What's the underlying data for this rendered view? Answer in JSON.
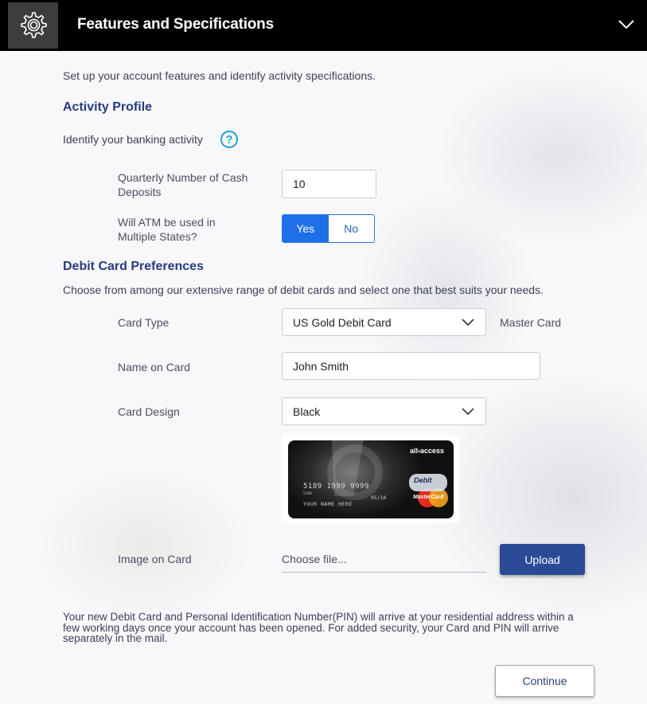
{
  "header": {
    "title": "Features and Specifications",
    "icon": "gear-icon",
    "toggle_icon": "chevron-down-icon"
  },
  "intro": "Set up your account features and identify activity specifications.",
  "activity": {
    "heading": "Activity Profile",
    "prompt": "Identify your banking activity",
    "help_glyph": "?",
    "cash_deposits_label": "Quarterly Number of Cash Deposits",
    "cash_deposits_value": "10",
    "atm_label": "Will ATM be used in Multiple States?",
    "atm_yes": "Yes",
    "atm_no": "No",
    "atm_selected": "Yes"
  },
  "debit": {
    "heading": "Debit Card Preferences",
    "prompt": "Choose from among our extensive range of debit cards and select one that best suits your needs.",
    "card_type_label": "Card Type",
    "card_type_value": "US Gold Debit Card",
    "card_network": "Master Card",
    "name_label": "Name on Card",
    "name_value": "John Smith",
    "design_label": "Card Design",
    "design_value": "Black",
    "card_preview": {
      "brand": "all›access",
      "number": "5189 1999 9999",
      "small_number": "5189",
      "expiry": "05/10",
      "holder": "YOUR NAME HERE",
      "badge": "Debit",
      "network": "MasterCard"
    },
    "image_label": "Image on Card",
    "file_placeholder": "Choose file...",
    "upload_label": "Upload"
  },
  "note": "Your new Debit Card and Personal Identification Number(PIN) will arrive at your residential address within a few working days once your account has been opened. For added security, your Card and PIN will arrive separately in the mail.",
  "continue_label": "Continue",
  "colors": {
    "header_bg": "#000000",
    "heading": "#253b80",
    "toggle_active": "#1f6fe8",
    "upload_bg": "#2b4a96",
    "help": "#1f9bd7"
  }
}
